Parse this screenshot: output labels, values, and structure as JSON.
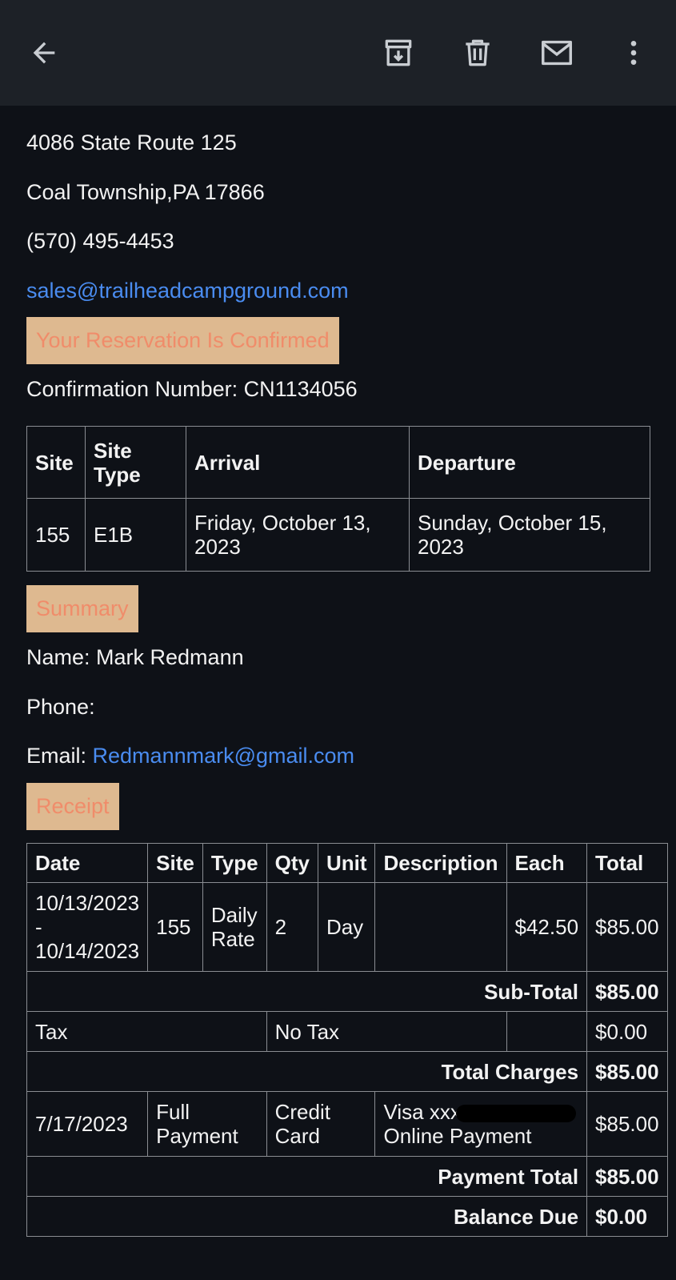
{
  "colors": {
    "background": "#0e1117",
    "topbar": "#1d2127",
    "link": "#4a8cf0",
    "banner_bg": "#deb990",
    "banner_text": "#f08c6a",
    "border": "#8a8d92"
  },
  "toolbar": {
    "back_icon": "arrow-left-icon",
    "archive_icon": "archive-icon",
    "delete_icon": "trash-icon",
    "mail_icon": "mail-icon",
    "more_icon": "more-vert-icon"
  },
  "address": {
    "street": "4086 State Route 125",
    "city": "Coal Township,PA 17866",
    "phone": "(570) 495-4453",
    "email": "sales@trailheadcampground.com"
  },
  "confirmation": {
    "banner": "Your Reservation Is Confirmed",
    "number_line": "Confirmation Number: CN1134056"
  },
  "reservation_table": {
    "headers": [
      "Site",
      "Site Type",
      "Arrival",
      "Departure"
    ],
    "row": [
      "155",
      "E1B",
      "Friday, October 13, 2023",
      "Sunday, October 15, 2023"
    ]
  },
  "summary": {
    "banner": "Summary",
    "name": "Name: Mark Redmann",
    "phone": "Phone:",
    "email_label": "Email:",
    "email": "Redmannmark@gmail.com"
  },
  "receipt": {
    "banner": "Receipt",
    "headers": [
      "Date",
      "Site",
      "Type",
      "Qty",
      "Unit",
      "Description",
      "Each",
      "Total"
    ],
    "item": {
      "date": "10/13/2023 - 10/14/2023",
      "site": "155",
      "type": "Daily Rate",
      "qty": "2",
      "unit": "Day",
      "description": "",
      "each": "$42.50",
      "total": "$85.00"
    },
    "subtotal_label": "Sub-Total",
    "subtotal": "$85.00",
    "tax_label": "Tax",
    "tax_desc": "No Tax",
    "tax": "$0.00",
    "total_charges_label": "Total Charges",
    "total_charges": "$85.00",
    "payment": {
      "date": "7/17/2023",
      "type": "Full Payment",
      "method": "Credit Card",
      "desc_prefix": "Visa xxx",
      "desc_line2": "Online Payment",
      "amount": "$85.00"
    },
    "payment_total_label": "Payment Total",
    "payment_total": "$85.00",
    "balance_due_label": "Balance Due",
    "balance_due": "$0.00"
  }
}
